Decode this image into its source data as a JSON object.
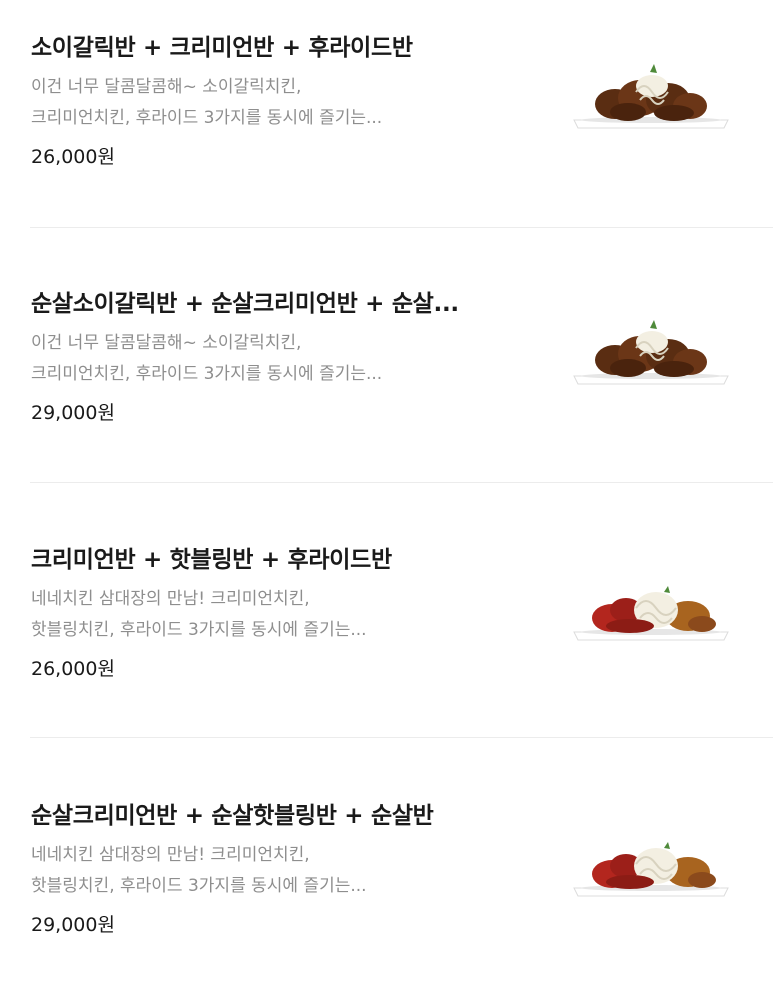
{
  "menu": {
    "items": [
      {
        "name": "소이갈릭반 + 크리미언반 + 후라이드반",
        "desc_line1": "이건 너무 달콤달콤해~ 소이갈릭치킨,",
        "desc_line2": "크리미언치킨, 후라이드 3가지를 동시에 즐기는...",
        "price": "26,000원",
        "photo_style": "soy"
      },
      {
        "name": "순살소이갈릭반 + 순살크리미언반 + 순살...",
        "desc_line1": "이건 너무 달콤달콤해~ 소이갈릭치킨,",
        "desc_line2": "크리미언치킨, 후라이드 3가지를 동시에 즐기는...",
        "price": "29,000원",
        "photo_style": "soy"
      },
      {
        "name": "크리미언반 + 핫블링반 + 후라이드반",
        "desc_line1": "네네치킨 삼대장의 만남! 크리미언치킨,",
        "desc_line2": "핫블링치킨, 후라이드 3가지를 동시에 즐기는...",
        "price": "26,000원",
        "photo_style": "hot"
      },
      {
        "name": "순살크리미언반 + 순살핫블링반 + 순살반",
        "desc_line1": "네네치킨 삼대장의 만남! 크리미언치킨,",
        "desc_line2": "핫블링치킨, 후라이드 3가지를 동시에 즐기는...",
        "price": "29,000원",
        "photo_style": "hot"
      }
    ]
  },
  "colors": {
    "text_primary": "#1a1a1a",
    "text_secondary": "#8e8e8e",
    "divider": "#ececec",
    "plate": "#ffffff",
    "fried_chicken": "#8b4a1c",
    "soy_glaze": "#5a2d12",
    "hot_sauce": "#b3261e",
    "cream_onion": "#f3efe2",
    "garnish": "#4f8a3a"
  }
}
